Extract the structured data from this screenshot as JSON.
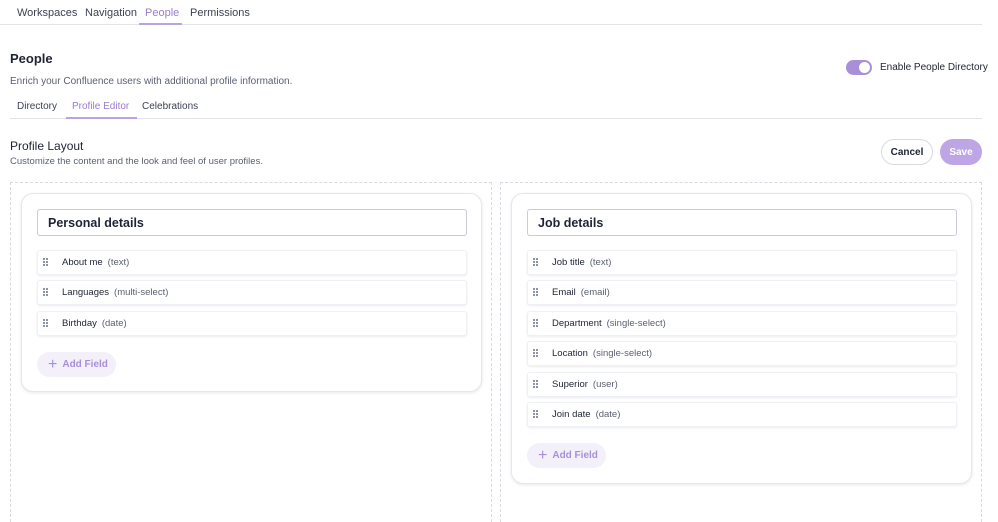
{
  "top_tabs": [
    {
      "label": "Workspaces"
    },
    {
      "label": "Navigation"
    },
    {
      "label": "People"
    },
    {
      "label": "Permissions"
    }
  ],
  "active_top_tab": "People",
  "page": {
    "title": "People",
    "description": "Enrich your Confluence users with additional profile information."
  },
  "directory_toggle": {
    "label": "Enable People Directory",
    "enabled": true
  },
  "sub_tabs": [
    {
      "label": "Directory"
    },
    {
      "label": "Profile Editor"
    },
    {
      "label": "Celebrations"
    }
  ],
  "active_sub_tab": "Profile Editor",
  "profile_layout": {
    "title": "Profile Layout",
    "description": "Customize the content and the look and feel of user profiles."
  },
  "actions": {
    "cancel_label": "Cancel",
    "save_label": "Save"
  },
  "colors": {
    "accent": "#a98fd8",
    "accent_light": "#bea6e6",
    "tab_active": "#9a7ccf"
  },
  "cards": [
    {
      "title": "Personal details",
      "fields": [
        {
          "name": "About me",
          "type": "(text)"
        },
        {
          "name": "Languages",
          "type": "(multi-select)"
        },
        {
          "name": "Birthday",
          "type": "(date)"
        }
      ],
      "add_label": "Add Field"
    },
    {
      "title": "Job details",
      "fields": [
        {
          "name": "Job title",
          "type": "(text)"
        },
        {
          "name": "Email",
          "type": "(email)"
        },
        {
          "name": "Department",
          "type": "(single-select)"
        },
        {
          "name": "Location",
          "type": "(single-select)"
        },
        {
          "name": "Superior",
          "type": "(user)"
        },
        {
          "name": "Join date",
          "type": "(date)"
        }
      ],
      "add_label": "Add Field"
    }
  ]
}
